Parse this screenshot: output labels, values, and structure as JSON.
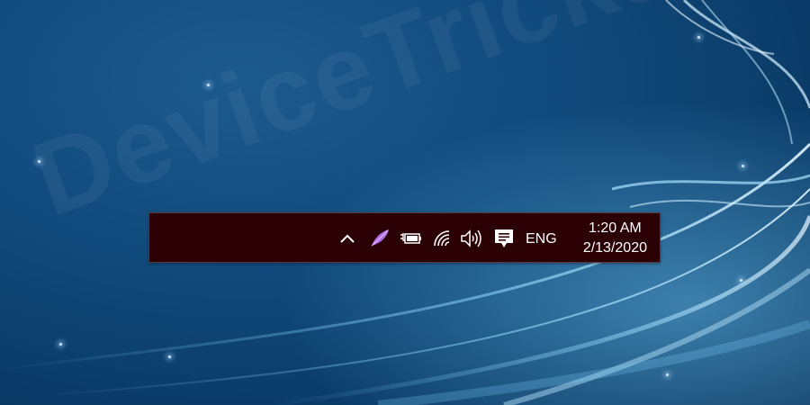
{
  "desktop": {
    "watermark": "DeviceTricks"
  },
  "taskbar": {
    "tray_icons": [
      {
        "name": "chevron-up-icon",
        "label": "Show hidden icons"
      },
      {
        "name": "feather-app-icon",
        "label": "App tray icon"
      },
      {
        "name": "battery-charging-icon",
        "label": "Power"
      },
      {
        "name": "wifi-icon",
        "label": "Network"
      },
      {
        "name": "volume-icon",
        "label": "Volume"
      },
      {
        "name": "notification-icon",
        "label": "Action center"
      }
    ],
    "language": "ENG",
    "clock": {
      "time": "1:20 AM",
      "date": "2/13/2020"
    },
    "colors": {
      "tray_background": "#2a0004",
      "feather_accent": "#b26be6"
    }
  }
}
